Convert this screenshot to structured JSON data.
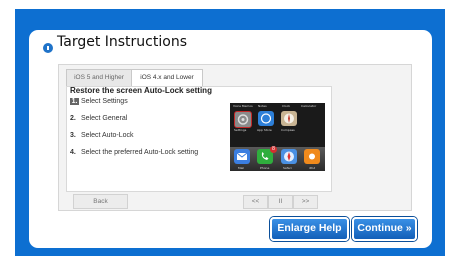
{
  "panel": {
    "title": "Target Instructions"
  },
  "tabs": [
    {
      "label": "iOS 5 and Higher",
      "active": false
    },
    {
      "label": "iOS 4.x and Lower",
      "active": true
    }
  ],
  "instructions": {
    "heading": "Restore the screen Auto-Lock setting",
    "steps": [
      {
        "num": "1.",
        "text": "Select Settings"
      },
      {
        "num": "2.",
        "text": "Select General"
      },
      {
        "num": "3.",
        "text": "Select Auto-Lock"
      },
      {
        "num": "4.",
        "text": "Select the preferred Auto-Lock setting"
      }
    ]
  },
  "phone_screen": {
    "top_labels": [
      "Voice Memos",
      "Notes",
      "Clock",
      "Calculator"
    ],
    "row_labels": [
      "Settings",
      "App Store",
      "Compass"
    ],
    "dock_labels": [
      "Mail",
      "Phone",
      "Safari",
      "iPod"
    ],
    "badge": "8"
  },
  "navigation": {
    "back_label": "Back",
    "prev_label": "<<",
    "pause_label": "II",
    "next_label": ">>"
  },
  "buttons": {
    "enlarge_help": "Enlarge Help",
    "continue": "Continue »"
  },
  "colors": {
    "background_blue": "#0d6fd1",
    "button_blue": "#1f73c9"
  }
}
